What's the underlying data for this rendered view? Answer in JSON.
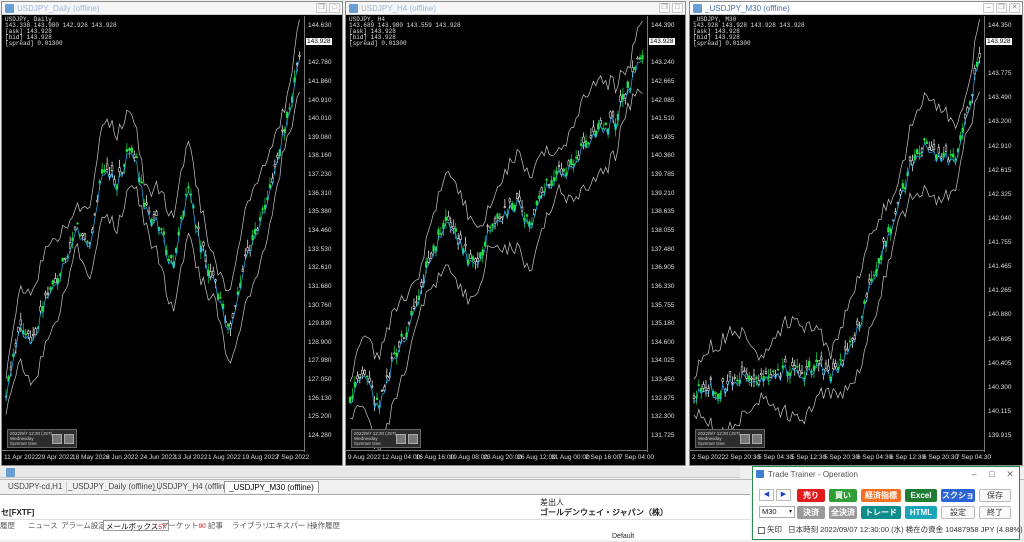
{
  "windows": [
    {
      "title": "USDJPY_Daily (offline)",
      "info": [
        "USDJPY, Daily",
        "143.338 143.980 142.926 143.928",
        "[ask] 143.928",
        "[bid] 143.928",
        "[spread] 0.01300"
      ],
      "price_tag": "143.928",
      "yticks": [
        "144.630",
        "143.928",
        "142.780",
        "141.860",
        "140.910",
        "140.010",
        "139.080",
        "138.160",
        "137.230",
        "136.310",
        "135.380",
        "134.460",
        "133.530",
        "132.610",
        "131.680",
        "130.760",
        "129.830",
        "128.900",
        "127.980",
        "127.050",
        "126.130",
        "125.200",
        "124.280"
      ],
      "xticks": [
        "11 Apr 2022",
        "29 Apr 2022",
        "18 May 2022",
        "6 Jun 2022",
        "24 Jun 2022",
        "13 Jul 2022",
        "1 Aug 2022",
        "19 Aug 2022",
        "7 Sep 2022"
      ],
      "clock": [
        "2022/9/7 12:30 (JST)",
        "Wednesday",
        "Summer time",
        "0 6"
      ]
    },
    {
      "title": "USDJPY_H4 (offline)",
      "info": [
        "USDJPY, H4",
        "143.689 143.980 143.559 143.928",
        "[ask] 143.928",
        "[bid] 143.928",
        "[spread] 0.01300"
      ],
      "price_tag": "143.928",
      "yticks": [
        "144.390",
        "143.928",
        "143.240",
        "142.665",
        "142.085",
        "141.510",
        "140.935",
        "140.360",
        "139.785",
        "139.210",
        "138.635",
        "138.055",
        "137.480",
        "136.905",
        "136.330",
        "135.755",
        "135.180",
        "134.600",
        "134.025",
        "133.450",
        "132.875",
        "132.300",
        "131.725"
      ],
      "xticks": [
        "9 Aug 2022",
        "12 Aug 04:00",
        "16 Aug 16:00",
        "19 Aug 08:00",
        "23 Aug 20:00",
        "26 Aug 12:00",
        "31 Aug 00:00",
        "2 Sep 16:00",
        "7 Sep 04:00"
      ],
      "clock": [
        "2022/9/7 12:30 (JST)",
        "Wednesday",
        "Summer time",
        "0 6"
      ]
    },
    {
      "title": "_USDJPY_M30 (offline)",
      "info": [
        "_USDJPY, M30",
        "143.928 143.928 143.928 143.928",
        "[ask] 143.928",
        "[bid] 143.928",
        "[spread] 0.01300"
      ],
      "price_tag": "143.928",
      "yticks": [
        "144.350",
        "143.928",
        "143.775",
        "143.490",
        "143.200",
        "142.910",
        "142.615",
        "142.325",
        "142.040",
        "141.755",
        "141.465",
        "141.265",
        "140.880",
        "140.695",
        "140.405",
        "140.300",
        "140.115",
        "139.915"
      ],
      "xticks": [
        "2 Sep 2022",
        "2 Sep 20:30",
        "5 Sep 04:30",
        "5 Sep 12:30",
        "5 Sep 20:30",
        "6 Sep 04:30",
        "6 Sep 12:30",
        "6 Sep 20:30",
        "7 Sep 04:30"
      ],
      "clock": [
        "2022/9/7 12:30 (JST)",
        "Wednesday",
        "Summer time",
        "0 6"
      ]
    }
  ],
  "chart_tabs": [
    "USDJPY-cd,H1",
    "_USDJPY_Daily (offline)",
    "_USDJPY_H4 (offline)",
    "_USDJPY_M30 (offline)"
  ],
  "active_chart_tab": 3,
  "terminal": {
    "side_label": "セ[FXTF]",
    "column_header": "差出人",
    "row_text": "ゴールデンウェイ・ジャパン（株）",
    "tabs": [
      {
        "label": "履歴",
        "badge": ""
      },
      {
        "label": "ニュース",
        "badge": ""
      },
      {
        "label": "アラーム設定",
        "badge": ""
      },
      {
        "label": "メールボックス",
        "badge": "57"
      },
      {
        "label": "マーケット",
        "badge": "90"
      },
      {
        "label": "記事",
        "badge": ""
      },
      {
        "label": "ライブラリ",
        "badge": ""
      },
      {
        "label": "エキスパート",
        "badge": ""
      },
      {
        "label": "操作履歴",
        "badge": ""
      }
    ],
    "bottom_text": "Default"
  },
  "trainer": {
    "title": "Trade Trainer - Operation",
    "buttons_row1": [
      {
        "label": "売り",
        "color": "#e21b1b"
      },
      {
        "label": "買い",
        "color": "#2f9e36"
      },
      {
        "label": "経済指標",
        "color": "#f36f21"
      },
      {
        "label": "Excel",
        "color": "#1e7d32"
      },
      {
        "label": "スクショ",
        "color": "#2a63d4"
      }
    ],
    "buttons_row2": [
      {
        "label": "決済",
        "color": "#9a9a9a"
      },
      {
        "label": "全決済",
        "color": "#9a9a9a"
      },
      {
        "label": "トレード",
        "color": "#0e8c8c"
      },
      {
        "label": "HTML",
        "color": "#1aa6b8"
      }
    ],
    "save_label": "保存",
    "settings_label": "設定",
    "exit_label": "終了",
    "timeframe": "M30",
    "status_check": "矢印",
    "status_text": "日本時刻 2022/09/07 12:30:00 (水)   検在の資金 10487958 JPY (4.88%)"
  },
  "colors": {
    "bull": "#22e04a",
    "bear": "#ffffff",
    "ma": "#29b6f6",
    "band": "#c8c8c8",
    "frame": "#2d8a4e"
  }
}
